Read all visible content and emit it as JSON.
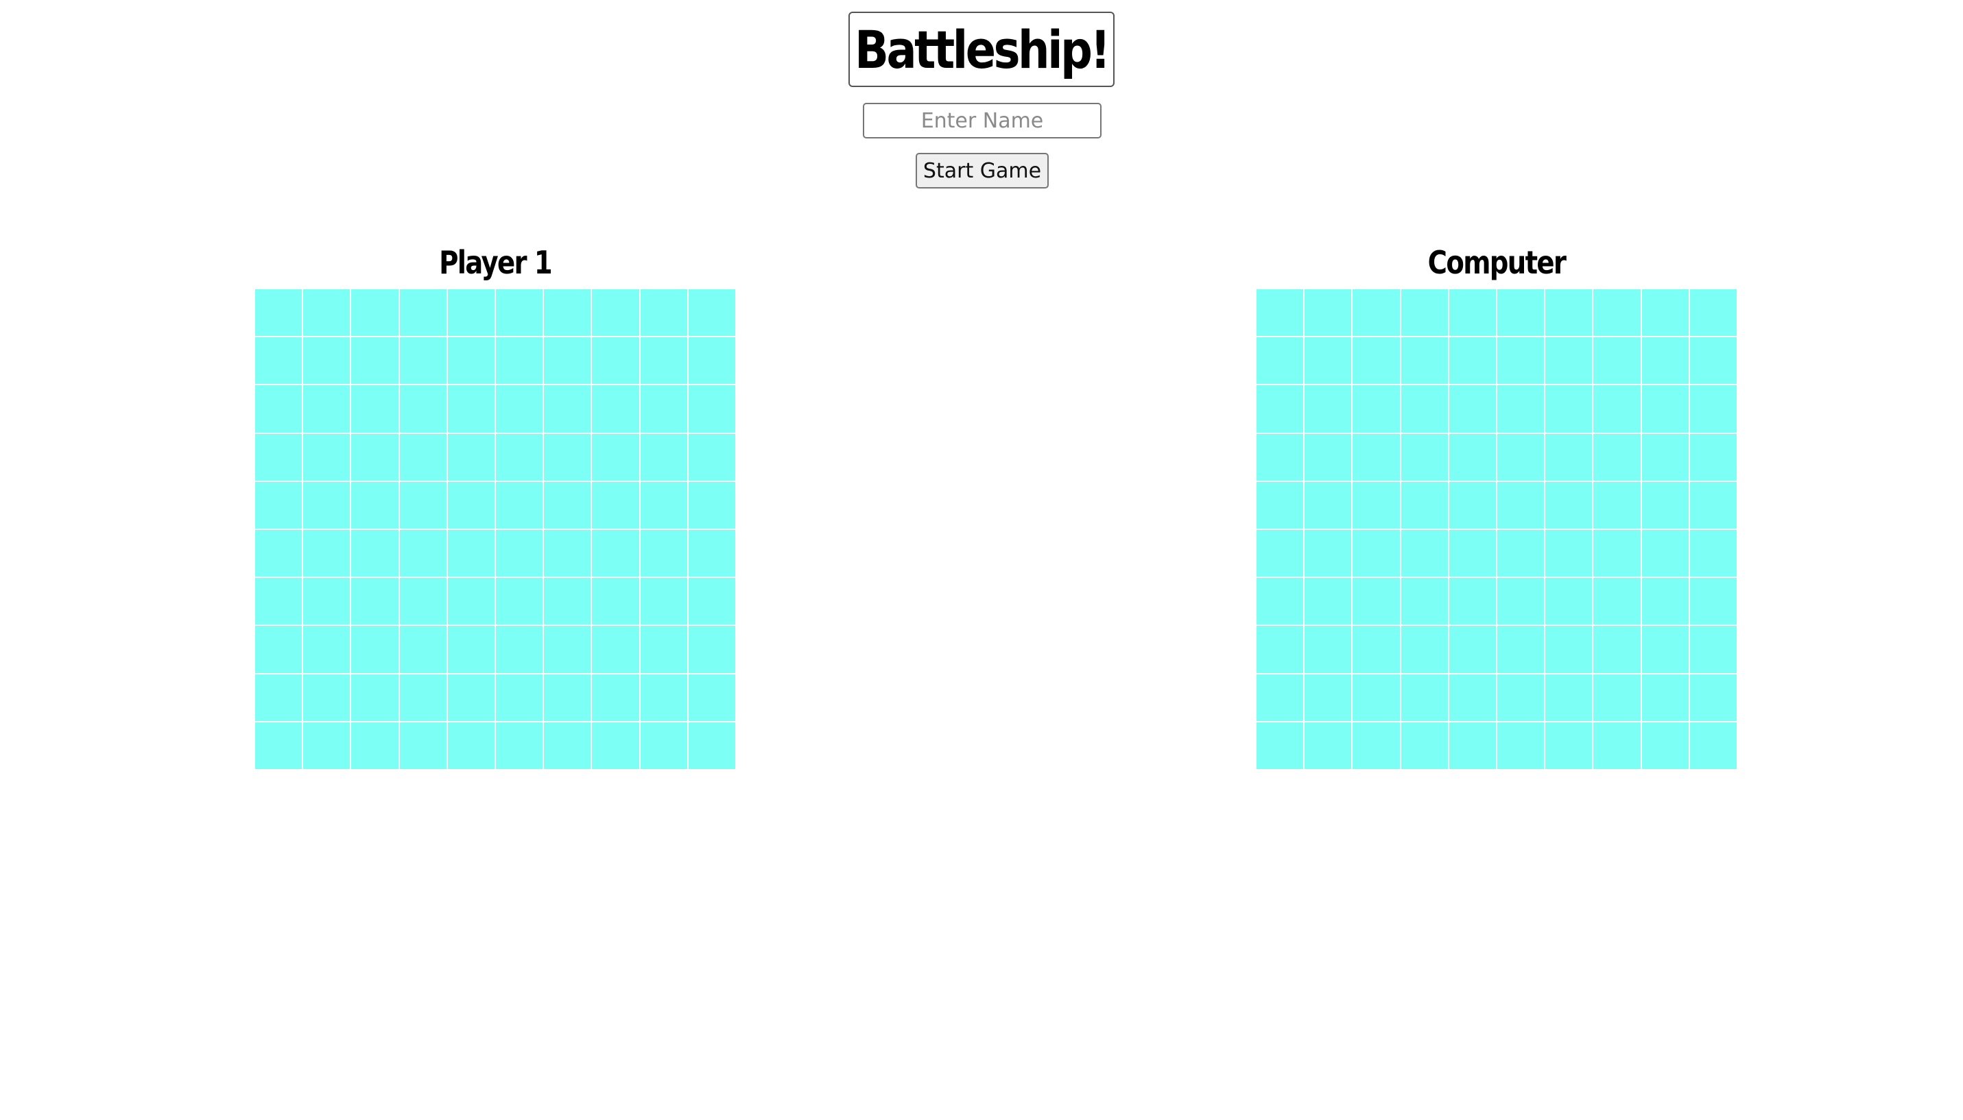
{
  "header": {
    "title": "Battleship!"
  },
  "setup": {
    "name_placeholder": "Enter Name",
    "name_value": "",
    "start_label": "Start Game"
  },
  "boards": {
    "player": {
      "label": "Player 1",
      "rows": 10,
      "cols": 10
    },
    "computer": {
      "label": "Computer",
      "rows": 10,
      "cols": 10
    }
  },
  "colors": {
    "water_cell": "#7cfff4",
    "grid_line": "#ffffff",
    "background": "#ffffff"
  }
}
